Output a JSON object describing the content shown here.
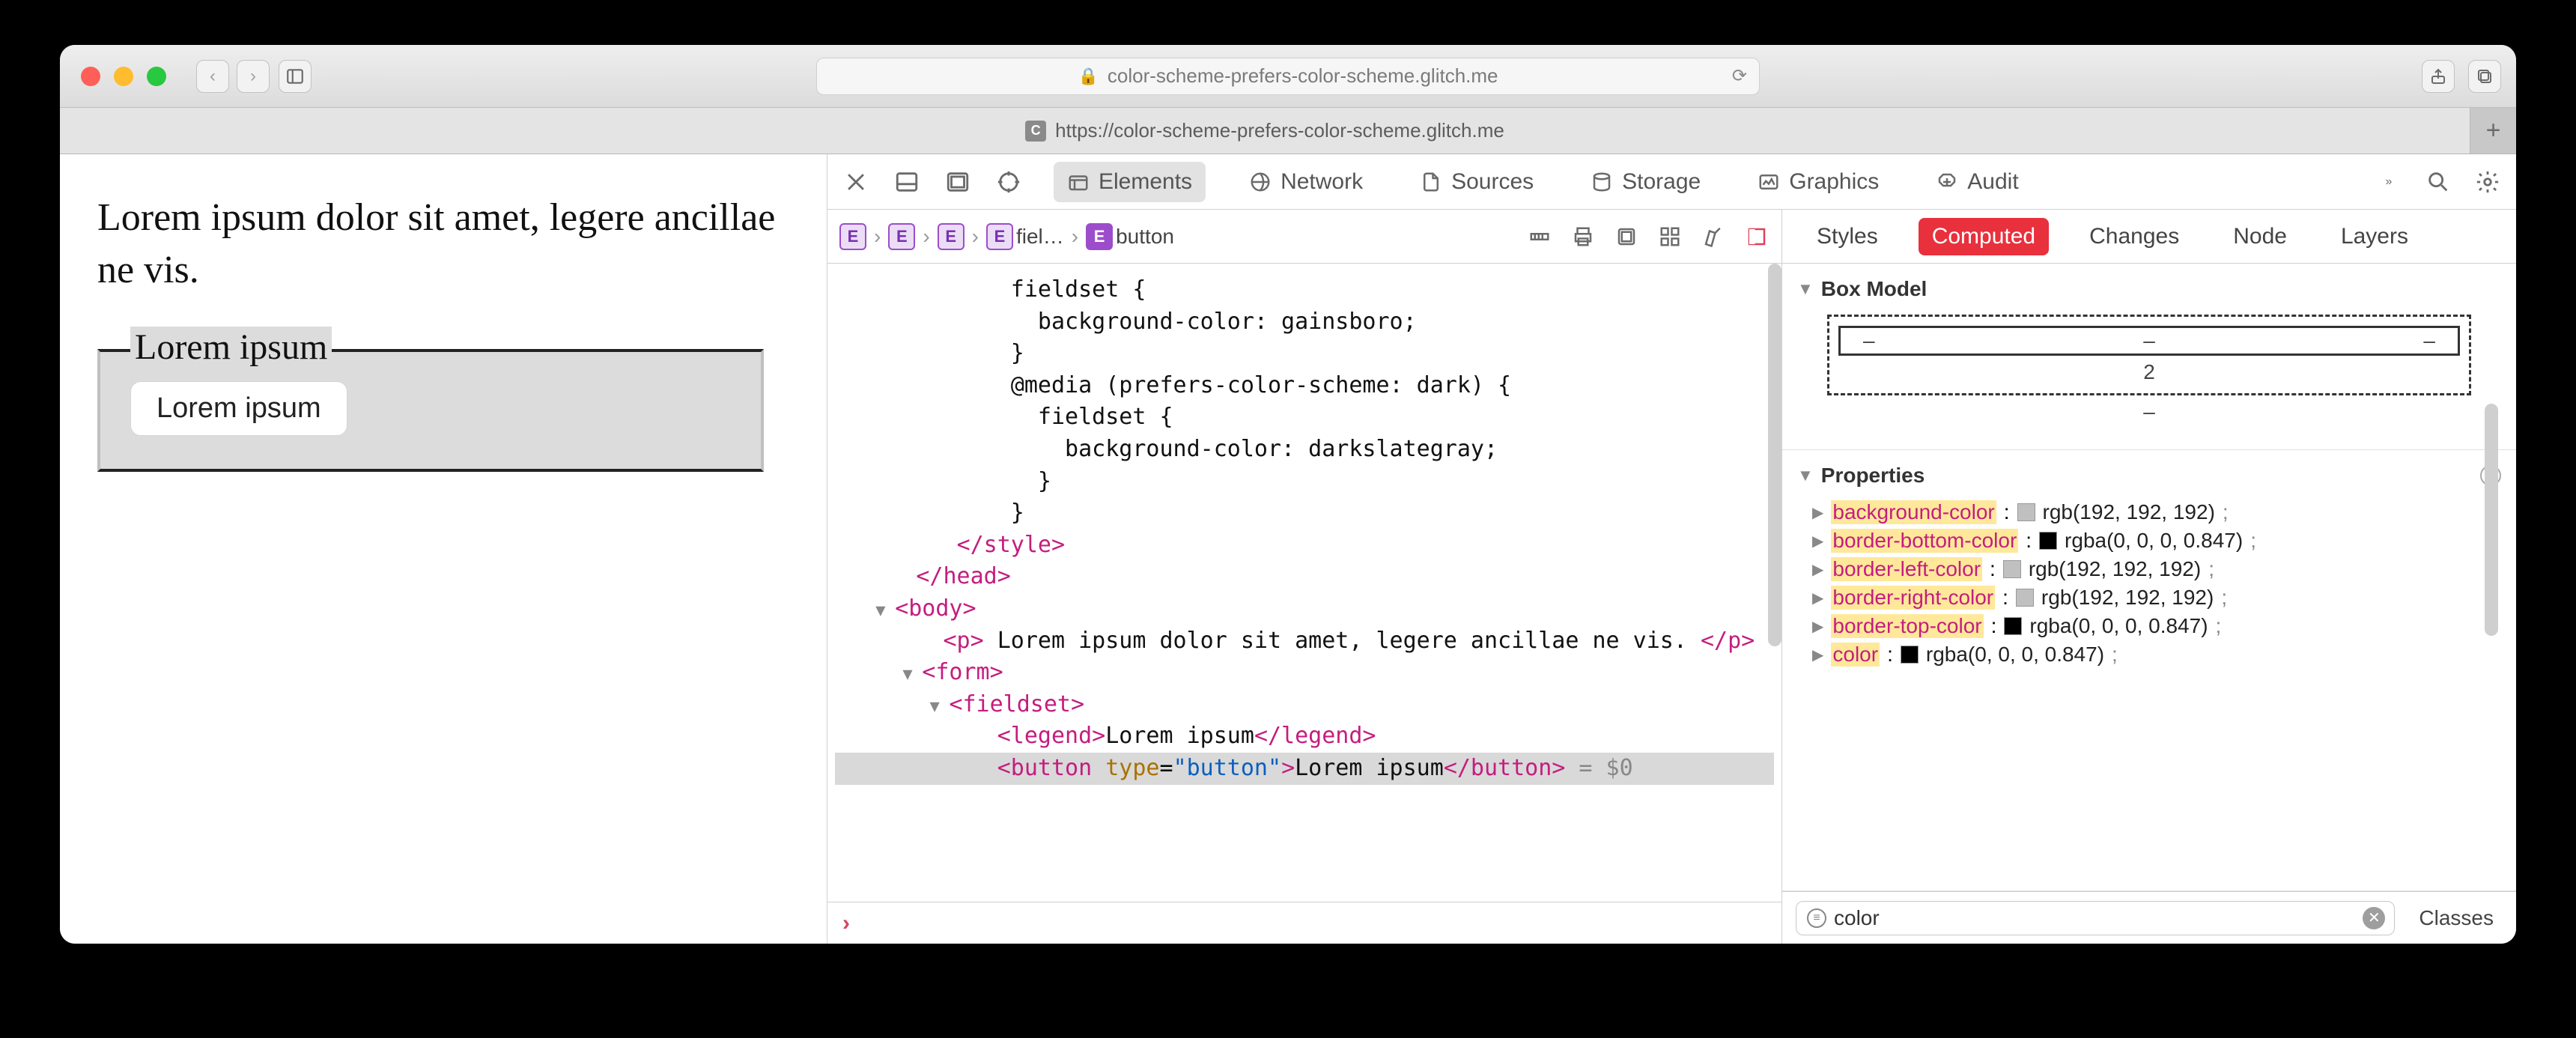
{
  "titlebar": {
    "url_display": "color-scheme-prefers-color-scheme.glitch.me"
  },
  "tab": {
    "title": "https://color-scheme-prefers-color-scheme.glitch.me",
    "favicon_letter": "C"
  },
  "page": {
    "paragraph": "Lorem ipsum dolor sit amet, legere ancillae ne vis.",
    "legend": "Lorem ipsum",
    "button_label": "Lorem ipsum"
  },
  "devtools": {
    "tabs": {
      "elements": "Elements",
      "network": "Network",
      "sources": "Sources",
      "storage": "Storage",
      "graphics": "Graphics",
      "audit": "Audit"
    },
    "breadcrumb": {
      "items": [
        "",
        "",
        "",
        "fiel…",
        "button"
      ]
    },
    "dom": {
      "l1": "             fieldset {",
      "l2": "               background-color: gainsboro;",
      "l3": "             }",
      "l4": "             @media (prefers-color-scheme: dark) {",
      "l5": "               fieldset {",
      "l6": "                 background-color: darkslategray;",
      "l7": "               }",
      "l8": "             }",
      "l9": "</style>",
      "l10": "</head>",
      "l11": "<body>",
      "p_open": "<p>",
      "p_text": " Lorem ipsum dolor sit amet, legere ancillae ne vis. ",
      "p_close": "</p>",
      "form": "<form>",
      "fieldset": "<fieldset>",
      "legend_open": "<legend>",
      "legend_text": "Lorem ipsum",
      "legend_close": "</legend>",
      "button_open": "<button",
      "button_attr_n": "type",
      "button_attr_v": "\"button\"",
      "button_text": "Lorem ipsum",
      "button_close": "</button>",
      "eq0": " = $0"
    },
    "side_tabs": {
      "styles": "Styles",
      "computed": "Computed",
      "changes": "Changes",
      "node": "Node",
      "layers": "Layers"
    },
    "box_model": {
      "title": "Box Model",
      "dash": "–",
      "number": "2"
    },
    "properties": {
      "title": "Properties",
      "rows": [
        {
          "name": "background-color",
          "swatch": "#c0c0c0",
          "value": "rgb(192, 192, 192)"
        },
        {
          "name": "border-bottom-color",
          "swatch": "#000000",
          "value": "rgba(0, 0, 0, 0.847)"
        },
        {
          "name": "border-left-color",
          "swatch": "#c0c0c0",
          "value": "rgb(192, 192, 192)"
        },
        {
          "name": "border-right-color",
          "swatch": "#c0c0c0",
          "value": "rgb(192, 192, 192)"
        },
        {
          "name": "border-top-color",
          "swatch": "#000000",
          "value": "rgba(0, 0, 0, 0.847)"
        },
        {
          "name": "color",
          "swatch": "#000000",
          "value": "rgba(0, 0, 0, 0.847)"
        }
      ]
    },
    "filter": {
      "value": "color",
      "classes_label": "Classes"
    }
  }
}
